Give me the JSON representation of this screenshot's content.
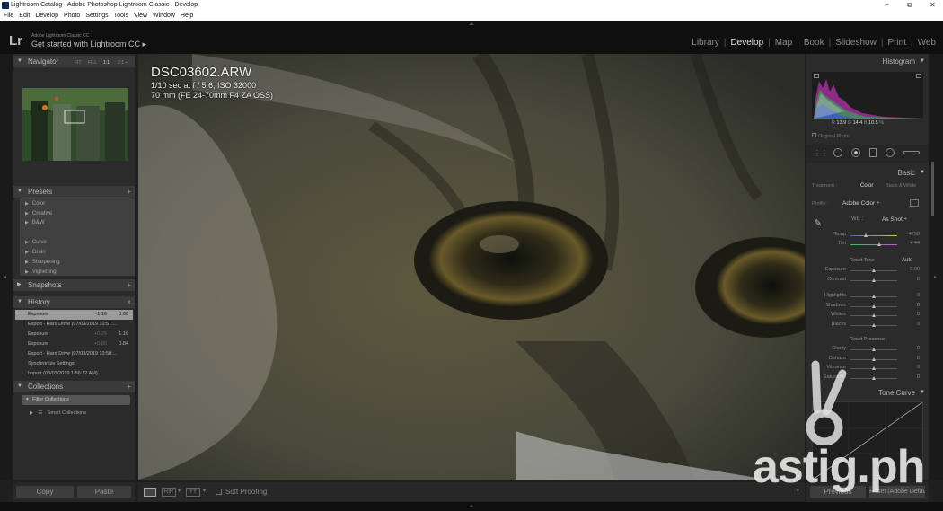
{
  "window": {
    "title": "Lightroom Catalog - Adobe Photoshop Lightroom Classic - Develop",
    "controls": [
      "–",
      "⧉",
      "✕"
    ]
  },
  "menu": [
    "File",
    "Edit",
    "Develop",
    "Photo",
    "Settings",
    "Tools",
    "View",
    "Window",
    "Help"
  ],
  "identity": {
    "logo": "Lr",
    "line1": "Adobe Lightroom Classic CC",
    "line2": "Get started with Lightroom CC ▸"
  },
  "modules": {
    "items": [
      "Library",
      "Develop",
      "Map",
      "Book",
      "Slideshow",
      "Print",
      "Web"
    ],
    "active": "Develop",
    "separator": "|"
  },
  "navigator": {
    "title": "Navigator",
    "zoom_options": [
      "FIT",
      "FILL",
      "1:1",
      "2:1 ÷"
    ]
  },
  "presets": {
    "title": "Presets",
    "items": [
      "Color",
      "Creative",
      "B&W",
      "Curve",
      "Grain",
      "Sharpening",
      "Vignetting"
    ]
  },
  "snapshots": {
    "title": "Snapshots"
  },
  "history": {
    "title": "History",
    "close": "×",
    "rows": [
      {
        "label": "Exposure",
        "v1": "-1.16",
        "v2": "0.00"
      },
      {
        "label": "Export - Hard Drive (07/03/2019 10:51:...",
        "v1": "",
        "v2": ""
      },
      {
        "label": "Exposure",
        "v1": "+0.25",
        "v2": "1.16"
      },
      {
        "label": "Exposure",
        "v1": "+0.90",
        "v2": "0.84"
      },
      {
        "label": "Export - Hard Drive (07/03/2019 10:50:...",
        "v1": "",
        "v2": ""
      },
      {
        "label": "Synchronize Settings",
        "v1": "",
        "v2": ""
      },
      {
        "label": "Import (03/03/2019 1:56:12 AM)",
        "v1": "",
        "v2": ""
      }
    ]
  },
  "collections": {
    "title": "Collections",
    "filter_placeholder": "Filter Collections",
    "smart": "Smart Collections"
  },
  "left_buttons": {
    "copy": "Copy",
    "paste": "Paste"
  },
  "photo": {
    "filename": "DSC03602.ARW",
    "exposure_line": "1/10 sec at f / 5.6, ISO 32000",
    "lens_line": "70 mm (FE 24-70mm F4 ZA OSS)"
  },
  "toolbar": {
    "soft_proofing": "Soft Proofing"
  },
  "histogram": {
    "title": "Histogram",
    "r_label": "R",
    "r_value": "13.9",
    "g_label": "G",
    "g_value": "14.4",
    "b_label": "B",
    "b_value": "10.5",
    "unit": "%",
    "original_photo": "Original Photo"
  },
  "basic": {
    "title": "Basic",
    "treatment_label": "Treatment :",
    "treatment_color": "Color",
    "treatment_bw": "Black & White",
    "profile_label": "Profile :",
    "profile_value": "Adobe Color ÷",
    "wb_label": "WB :",
    "wb_value": "As Shot ÷",
    "temp_label": "Temp",
    "temp_value": "4750",
    "temp_pos": 0.32,
    "tint_label": "Tint",
    "tint_value": "+ 44",
    "tint_pos": 0.62,
    "tone_label": "Reset Tone",
    "auto_label": "Auto",
    "presence_label": "Reset Presence",
    "sliders": [
      {
        "label": "Exposure",
        "value": "0.00",
        "pos": 0.5
      },
      {
        "label": "Contrast",
        "value": "0",
        "pos": 0.5
      },
      {
        "label": "Highlights",
        "value": "0",
        "pos": 0.5
      },
      {
        "label": "Shadows",
        "value": "0",
        "pos": 0.5
      },
      {
        "label": "Whites",
        "value": "0",
        "pos": 0.5
      },
      {
        "label": "Blacks",
        "value": "0",
        "pos": 0.5
      },
      {
        "label": "Clarity",
        "value": "0",
        "pos": 0.5
      },
      {
        "label": "Dehaze",
        "value": "0",
        "pos": 0.5
      },
      {
        "label": "Vibrance",
        "value": "0",
        "pos": 0.5
      },
      {
        "label": "Saturation",
        "value": "0",
        "pos": 0.5
      }
    ]
  },
  "tone_curve": {
    "title": "Tone Curve"
  },
  "right_buttons": {
    "previous": "Previous",
    "reset": "Reset (Adobe Default)"
  },
  "watermark": {
    "text": "astig.ph"
  },
  "colors": {
    "panel": "#2b2b2b",
    "header": "#3a3a3a",
    "accent_active": "#e6e6e6"
  }
}
